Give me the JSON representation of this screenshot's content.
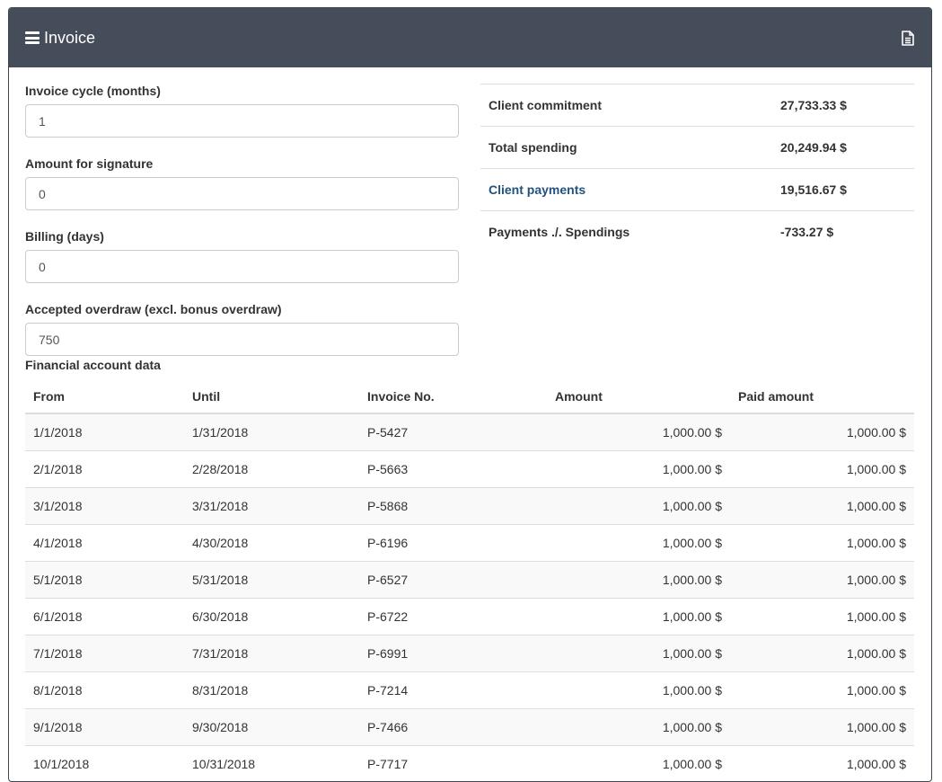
{
  "header": {
    "title": "Invoice"
  },
  "form": {
    "invoice_cycle": {
      "label": "Invoice cycle (months)",
      "value": "1"
    },
    "amount_signature": {
      "label": "Amount for signature",
      "value": "0"
    },
    "billing_days": {
      "label": "Billing (days)",
      "value": "0"
    },
    "accepted_overdraw": {
      "label": "Accepted overdraw (excl. bonus overdraw)",
      "value": "750"
    }
  },
  "summary": {
    "client_commitment": {
      "label": "Client commitment",
      "value": "27,733.33 $"
    },
    "total_spending": {
      "label": "Total spending",
      "value": "20,249.94 $"
    },
    "client_payments": {
      "label": "Client payments",
      "value": "19,516.67 $"
    },
    "payments_vs_spendings": {
      "label": "Payments ./. Spendings",
      "value": "-733.27 $"
    }
  },
  "financial": {
    "label": "Financial account data",
    "columns": {
      "from": "From",
      "until": "Until",
      "invoice_no": "Invoice No.",
      "amount": "Amount",
      "paid_amount": "Paid amount"
    },
    "rows": [
      {
        "from": "1/1/2018",
        "until": "1/31/2018",
        "invoice_no": "P-5427",
        "amount": "1,000.00 $",
        "paid": "1,000.00 $"
      },
      {
        "from": "2/1/2018",
        "until": "2/28/2018",
        "invoice_no": "P-5663",
        "amount": "1,000.00 $",
        "paid": "1,000.00 $"
      },
      {
        "from": "3/1/2018",
        "until": "3/31/2018",
        "invoice_no": "P-5868",
        "amount": "1,000.00 $",
        "paid": "1,000.00 $"
      },
      {
        "from": "4/1/2018",
        "until": "4/30/2018",
        "invoice_no": "P-6196",
        "amount": "1,000.00 $",
        "paid": "1,000.00 $"
      },
      {
        "from": "5/1/2018",
        "until": "5/31/2018",
        "invoice_no": "P-6527",
        "amount": "1,000.00 $",
        "paid": "1,000.00 $"
      },
      {
        "from": "6/1/2018",
        "until": "6/30/2018",
        "invoice_no": "P-6722",
        "amount": "1,000.00 $",
        "paid": "1,000.00 $"
      },
      {
        "from": "7/1/2018",
        "until": "7/31/2018",
        "invoice_no": "P-6991",
        "amount": "1,000.00 $",
        "paid": "1,000.00 $"
      },
      {
        "from": "8/1/2018",
        "until": "8/31/2018",
        "invoice_no": "P-7214",
        "amount": "1,000.00 $",
        "paid": "1,000.00 $"
      },
      {
        "from": "9/1/2018",
        "until": "9/30/2018",
        "invoice_no": "P-7466",
        "amount": "1,000.00 $",
        "paid": "1,000.00 $"
      },
      {
        "from": "10/1/2018",
        "until": "10/31/2018",
        "invoice_no": "P-7717",
        "amount": "1,000.00 $",
        "paid": "1,000.00 $"
      }
    ]
  }
}
